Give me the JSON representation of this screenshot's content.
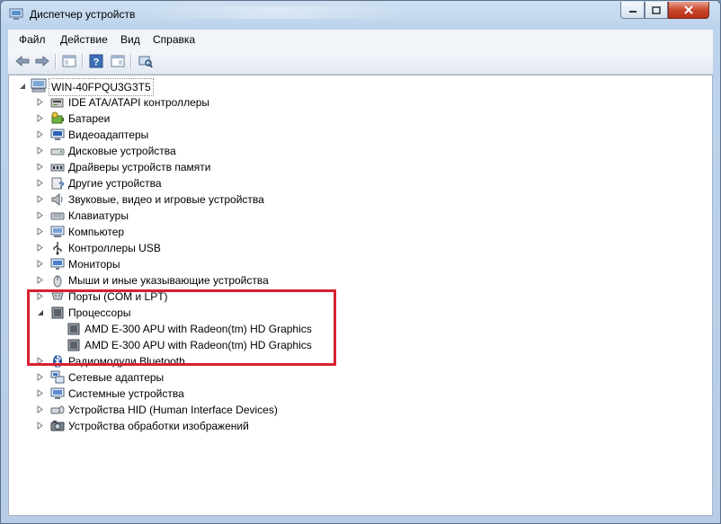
{
  "window": {
    "title": "Диспетчер устройств"
  },
  "menu": {
    "file": "Файл",
    "action": "Действие",
    "view": "Вид",
    "help": "Справка"
  },
  "tree": {
    "root": "WIN-40FPQU3G3T5",
    "categories": [
      {
        "label": "IDE ATA/ATAPI контроллеры",
        "icon": "ide-controller-icon",
        "expanded": false
      },
      {
        "label": "Батареи",
        "icon": "battery-icon",
        "expanded": false
      },
      {
        "label": "Видеоадаптеры",
        "icon": "display-adapter-icon",
        "expanded": false
      },
      {
        "label": "Дисковые устройства",
        "icon": "disk-drive-icon",
        "expanded": false
      },
      {
        "label": "Драйверы устройств памяти",
        "icon": "memory-driver-icon",
        "expanded": false
      },
      {
        "label": "Другие устройства",
        "icon": "unknown-device-icon",
        "expanded": false
      },
      {
        "label": "Звуковые, видео и игровые устройства",
        "icon": "speaker-icon",
        "expanded": false
      },
      {
        "label": "Клавиатуры",
        "icon": "keyboard-icon",
        "expanded": false
      },
      {
        "label": "Компьютер",
        "icon": "computer-icon",
        "expanded": false
      },
      {
        "label": "Контроллеры USB",
        "icon": "usb-icon",
        "expanded": false
      },
      {
        "label": "Мониторы",
        "icon": "monitor-icon",
        "expanded": false
      },
      {
        "label": "Мыши и иные указывающие устройства",
        "icon": "mouse-icon",
        "expanded": false
      },
      {
        "label": "Порты (COM и LPT)",
        "icon": "port-icon",
        "expanded": false
      },
      {
        "label": "Процессоры",
        "icon": "processor-icon",
        "expanded": true
      },
      {
        "label": "Радиомодули Bluetooth",
        "icon": "bluetooth-icon",
        "expanded": false
      },
      {
        "label": "Сетевые адаптеры",
        "icon": "network-adapter-icon",
        "expanded": false
      },
      {
        "label": "Системные устройства",
        "icon": "system-device-icon",
        "expanded": false
      },
      {
        "label": "Устройства HID (Human Interface Devices)",
        "icon": "hid-icon",
        "expanded": false
      },
      {
        "label": "Устройства обработки изображений",
        "icon": "camera-icon",
        "expanded": false
      }
    ],
    "processors": [
      "AMD E-300 APU with Radeon(tm) HD Graphics",
      "AMD E-300 APU with Radeon(tm) HD Graphics"
    ]
  },
  "colors": {
    "highlight": "#d92030",
    "close_button": "#c9462c"
  }
}
